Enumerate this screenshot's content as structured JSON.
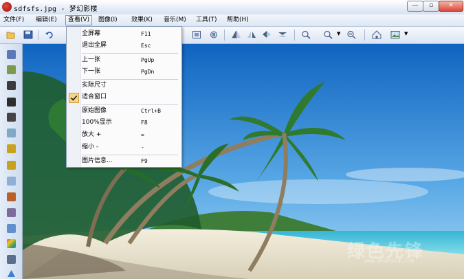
{
  "window": {
    "title": "sdfsfs.jpg - 梦幻影楼",
    "minimize_label": "—",
    "restore_label": "▫",
    "close_label": "✕"
  },
  "menubar": {
    "items": [
      {
        "label": "文件(F)"
      },
      {
        "label": "编辑(E)"
      },
      {
        "label": "查看(V)"
      },
      {
        "label": "图像(I)"
      },
      {
        "label": "效果(K)"
      },
      {
        "label": "音乐(M)"
      },
      {
        "label": "工具(T)"
      },
      {
        "label": "帮助(H)"
      }
    ]
  },
  "view_menu": {
    "items": [
      {
        "label": "全屏幕",
        "shortcut": "F11"
      },
      {
        "label": "退出全屏",
        "shortcut": "Esc"
      },
      {
        "label": "上一张",
        "shortcut": "PgUp"
      },
      {
        "label": "下一张",
        "shortcut": "PgDn"
      },
      {
        "label": "实际尺寸",
        "shortcut": ""
      },
      {
        "label": "适合窗口",
        "shortcut": "",
        "checked": true
      },
      {
        "label": "原始图像",
        "shortcut": "Ctrl+B"
      },
      {
        "label": "100%显示",
        "shortcut": "F8"
      },
      {
        "label": "放大 +",
        "shortcut": "="
      },
      {
        "label": "缩小 -",
        "shortcut": "-"
      },
      {
        "label": "图片信息...",
        "shortcut": "F9"
      }
    ]
  },
  "toolbar": {
    "icons": [
      "open-folder-icon",
      "save-icon",
      "undo-icon",
      "fit-screen-icon",
      "rotate-icon",
      "flip-left-icon",
      "flip-right-icon",
      "mirror-icon",
      "mirror-alt-icon",
      "zoom-in-icon",
      "zoom-dropdown-icon",
      "zoom-out-icon",
      "home-icon",
      "picture-icon"
    ]
  },
  "sidebar": {
    "icons": [
      "filmstrip-first-icon",
      "album-icon",
      "filmstrip-icon",
      "page-one-icon",
      "page-two-icon",
      "image-icon",
      "slide-icon",
      "slide-alt-icon",
      "panel-icon",
      "camera-icon",
      "frame-icon",
      "stamp-icon",
      "palette-icon",
      "print-icon",
      "triangle-icon"
    ]
  },
  "watermark": {
    "text": "绿色先锋",
    "sub": "www.downxia.com"
  },
  "colors": {
    "accent": "#7b9ac6",
    "sky": "#2e8ad6",
    "sea": "#39c6d8",
    "sand": "#eae4d2"
  }
}
